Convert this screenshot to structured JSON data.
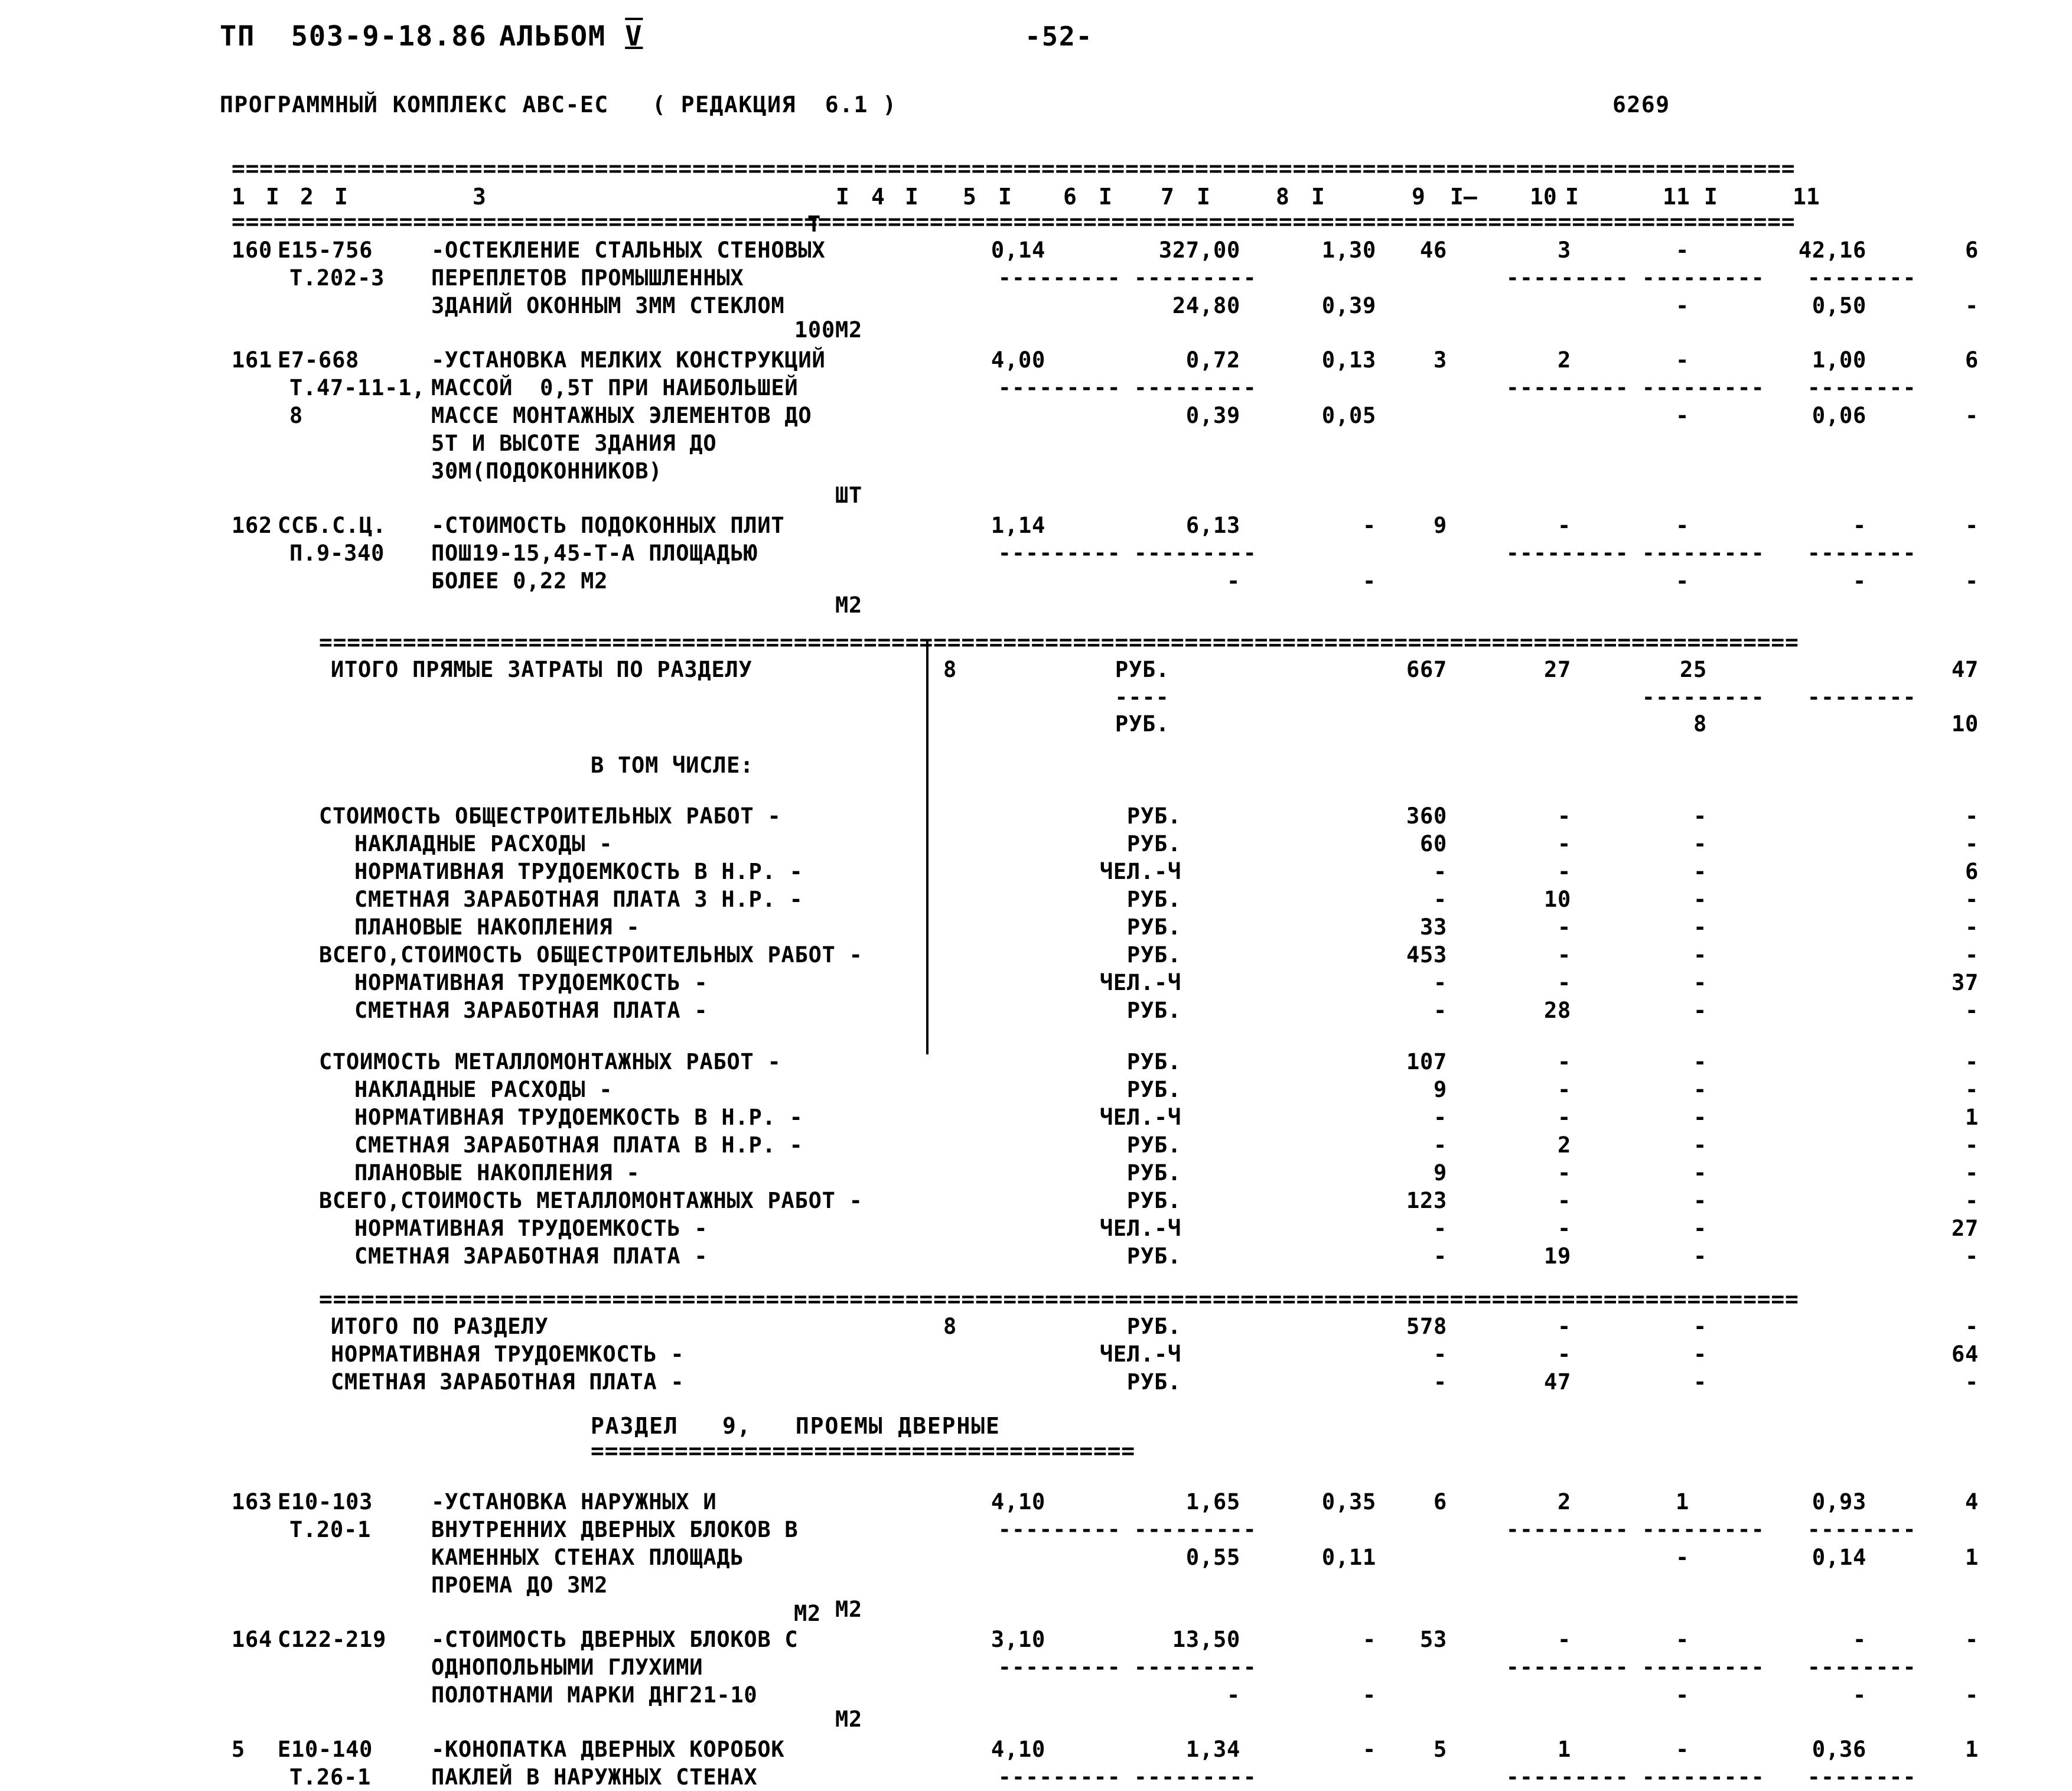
{
  "header": {
    "document_code": "ТП  503-9-18.86",
    "album_label": "АЛЬБОМ",
    "album_number": "V",
    "page_number": "-52-",
    "program_line": "ПРОГРАММНЫЙ КОМПЛЕКС АВС-ЕС   ( РЕДАКЦИЯ  6.1 )",
    "print_code": "6269"
  },
  "table": {
    "column_numbers": [
      "1",
      "2",
      "3",
      "4",
      "5",
      "6",
      "7",
      "8",
      "9",
      "10",
      "11"
    ],
    "separator_char": "=",
    "dash_char": "-",
    "empty_mark": "-"
  },
  "items": [
    {
      "no": "160",
      "code1": "Е15-756",
      "code2": "Т.202-3",
      "code3": "",
      "desc_lines": [
        "-ОСТЕКЛЕНИЕ СТАЛЬНЫХ СТЕНОВЫХ",
        "ПЕРЕПЛЕТОВ ПРОМЫШЛЕННЫХ",
        "ЗДАНИЙ ОКОННЫМ 3ММ СТЕКЛОМ"
      ],
      "unit_top": "Т",
      "unit_bottom": "100М2",
      "qty": "0,14",
      "price_a": "327,00",
      "price_b": "1,30",
      "price_a2": "24,80",
      "price_b2": "0,39",
      "c7": "46",
      "c8": "3",
      "c9": "-",
      "c10": "42,16",
      "c11": "6",
      "c8_2": "",
      "c9_2": "-",
      "c10_2": "0,50",
      "c11_2": "-"
    },
    {
      "no": "161",
      "code1": "Е7-668",
      "code2": "Т.47-11-1,",
      "code3": "8",
      "desc_lines": [
        "-УСТАНОВКА МЕЛКИХ КОНСТРУКЦИЙ",
        "МАССОЙ  0,5Т ПРИ НАИБОЛЬШЕЙ",
        "МАССЕ МОНТАЖНЫХ ЭЛЕМЕНТОВ ДО",
        "5Т И ВЫСОТЕ ЗДАНИЯ ДО",
        "30М(ПОДОКОННИКОВ)"
      ],
      "unit_top": "",
      "unit_bottom": "ШТ",
      "qty": "4,00",
      "price_a": "0,72",
      "price_b": "0,13",
      "price_a2": "0,39",
      "price_b2": "0,05",
      "c7": "3",
      "c8": "2",
      "c9": "-",
      "c10": "1,00",
      "c11": "6",
      "c8_2": "",
      "c9_2": "-",
      "c10_2": "0,06",
      "c11_2": "-"
    },
    {
      "no": "162",
      "code1": "ССБ.С.Ц.",
      "code2": "П.9-340",
      "code3": "",
      "desc_lines": [
        "-СТОИМОСТЬ ПОДОКОННЫХ ПЛИТ",
        "ПОШ19-15,45-Т-А ПЛОЩАДЬЮ",
        "БОЛЕЕ 0,22 М2"
      ],
      "unit_top": "",
      "unit_bottom": "М2",
      "qty": "1,14",
      "price_a": "6,13",
      "price_b": "-",
      "price_a2": "-",
      "price_b2": "-",
      "c7": "9",
      "c8": "-",
      "c9": "-",
      "c10": "-",
      "c11": "-",
      "c8_2": "",
      "c9_2": "-",
      "c10_2": "-",
      "c11_2": "-"
    }
  ],
  "totals_direct": {
    "label": "ИТОГО ПРЯМЫЕ ЗАТРАТЫ ПО РАЗДЕЛУ",
    "section_no": "8",
    "unit_1": "РУБ.",
    "unit_2": "РУБ.",
    "c7": "667",
    "c8": "27",
    "c9": "25",
    "c11": "47",
    "c9_2": "8",
    "c11_2": "10"
  },
  "in_that_number_label": "В ТОМ ЧИСЛЕ:",
  "breakdown_general": [
    {
      "label": "СТОИМОСТЬ ОБЩЕСТРОИТЕЛЬНЫХ РАБОТ -",
      "indent": 0,
      "unit": "РУБ.",
      "c7": "360",
      "c8": "-",
      "c9": "-",
      "c11": "-"
    },
    {
      "label": "НАКЛАДНЫЕ РАСХОДЫ -",
      "indent": 1,
      "unit": "РУБ.",
      "c7": "60",
      "c8": "-",
      "c9": "-",
      "c11": "-"
    },
    {
      "label": "НОРМАТИВНАЯ ТРУДОЕМКОСТЬ В Н.Р. -",
      "indent": 1,
      "unit": "ЧЕЛ.-Ч",
      "c7": "-",
      "c8": "-",
      "c9": "-",
      "c11": "6"
    },
    {
      "label": "СМЕТНАЯ ЗАРАБОТНАЯ ПЛАТА З Н.Р. -",
      "indent": 1,
      "unit": "РУБ.",
      "c7": "-",
      "c8": "10",
      "c9": "-",
      "c11": "-"
    },
    {
      "label": "ПЛАНОВЫЕ НАКОПЛЕНИЯ -",
      "indent": 1,
      "unit": "РУБ.",
      "c7": "33",
      "c8": "-",
      "c9": "-",
      "c11": "-"
    },
    {
      "label": "ВСЕГО,СТОИМОСТЬ ОБЩЕСТРОИТЕЛЬНЫХ РАБОТ -",
      "indent": 0,
      "unit": "РУБ.",
      "c7": "453",
      "c8": "-",
      "c9": "-",
      "c11": "-"
    },
    {
      "label": "НОРМАТИВНАЯ ТРУДОЕМКОСТЬ -",
      "indent": 1,
      "unit": "ЧЕЛ.-Ч",
      "c7": "-",
      "c8": "-",
      "c9": "-",
      "c11": "37"
    },
    {
      "label": "СМЕТНАЯ ЗАРАБОТНАЯ ПЛАТА -",
      "indent": 1,
      "unit": "РУБ.",
      "c7": "-",
      "c8": "28",
      "c9": "-",
      "c11": "-"
    }
  ],
  "breakdown_metal": [
    {
      "label": "СТОИМОСТЬ МЕТАЛЛОМОНТАЖНЫХ РАБОТ -",
      "indent": 0,
      "unit": "РУБ.",
      "c7": "107",
      "c8": "-",
      "c9": "-",
      "c11": "-"
    },
    {
      "label": "НАКЛАДНЫЕ РАСХОДЫ -",
      "indent": 1,
      "unit": "РУБ.",
      "c7": "9",
      "c8": "-",
      "c9": "-",
      "c11": "-"
    },
    {
      "label": "НОРМАТИВНАЯ ТРУДОЕМКОСТЬ В Н.Р. -",
      "indent": 1,
      "unit": "ЧЕЛ.-Ч",
      "c7": "-",
      "c8": "-",
      "c9": "-",
      "c11": "1"
    },
    {
      "label": "СМЕТНАЯ ЗАРАБОТНАЯ ПЛАТА В Н.Р. -",
      "indent": 1,
      "unit": "РУБ.",
      "c7": "-",
      "c8": "2",
      "c9": "-",
      "c11": "-"
    },
    {
      "label": "ПЛАНОВЫЕ НАКОПЛЕНИЯ -",
      "indent": 1,
      "unit": "РУБ.",
      "c7": "9",
      "c8": "-",
      "c9": "-",
      "c11": "-"
    },
    {
      "label": "ВСЕГО,СТОИМОСТЬ МЕТАЛЛОМОНТАЖНЫХ РАБОТ -",
      "indent": 0,
      "unit": "РУБ.",
      "c7": "123",
      "c8": "-",
      "c9": "-",
      "c11": "-"
    },
    {
      "label": "НОРМАТИВНАЯ ТРУДОЕМКОСТЬ -",
      "indent": 1,
      "unit": "ЧЕЛ.-Ч",
      "c7": "-",
      "c8": "-",
      "c9": "-",
      "c11": "27"
    },
    {
      "label": "СМЕТНАЯ ЗАРАБОТНАЯ ПЛАТА -",
      "indent": 1,
      "unit": "РУБ.",
      "c7": "-",
      "c8": "19",
      "c9": "-",
      "c11": "-"
    }
  ],
  "section_totals": [
    {
      "label": "ИТОГО ПО РАЗДЕЛУ",
      "section_no": "8",
      "unit": "РУБ.",
      "c7": "578",
      "c8": "-",
      "c9": "-",
      "c11": "-"
    },
    {
      "label": "НОРМАТИВНАЯ ТРУДОЕМКОСТЬ -",
      "section_no": "",
      "unit": "ЧЕЛ.-Ч",
      "c7": "-",
      "c8": "-",
      "c9": "-",
      "c11": "64"
    },
    {
      "label": "СМЕТНАЯ ЗАРАБОТНАЯ ПЛАТА -",
      "section_no": "",
      "unit": "РУБ.",
      "c7": "-",
      "c8": "47",
      "c9": "-",
      "c11": "-"
    }
  ],
  "next_section": {
    "title_word": "РАЗДЕЛ",
    "number": "9,",
    "name": "ПРОЕМЫ ДВЕРНЫЕ"
  },
  "items2": [
    {
      "no": "163",
      "code1": "Е10-103",
      "code2": "Т.20-1",
      "code3": "",
      "desc_lines": [
        "-УСТАНОВКА НАРУЖНЫХ И",
        "ВНУТРЕННИХ ДВЕРНЫХ БЛОКОВ В",
        "КАМЕННЫХ СТЕНАХ ПЛОЩАДЬ",
        "ПРОЕМА ДО 3М2"
      ],
      "unit_top": "",
      "unit_bottom": "М2",
      "qty": "4,10",
      "price_a": "1,65",
      "price_b": "0,35",
      "price_a2": "0,55",
      "price_b2": "0,11",
      "c7": "6",
      "c8": "2",
      "c9": "1",
      "c10": "0,93",
      "c11": "4",
      "c9_2": "-",
      "c10_2": "0,14",
      "c11_2": "1"
    },
    {
      "no": "164",
      "code1": "С122-219",
      "code2": "",
      "code3": "",
      "desc_lines": [
        "-СТОИМОСТЬ ДВЕРНЫХ БЛОКОВ С",
        "ОДНОПОЛЬНЫМИ ГЛУХИМИ",
        "ПОЛОТНАМИ МАРКИ ДНГ21-10"
      ],
      "unit_top": "М2",
      "unit_bottom": "М2",
      "qty": "3,10",
      "price_a": "13,50",
      "price_b": "-",
      "price_a2": "-",
      "price_b2": "-",
      "c7": "53",
      "c8": "-",
      "c9": "-",
      "c10": "-",
      "c11": "-",
      "c9_2": "-",
      "c10_2": "-",
      "c11_2": "-"
    },
    {
      "no": "5",
      "code1": "Е10-140",
      "code2": "Т.26-1",
      "code3": "",
      "desc_lines": [
        "-КОНОПАТКА ДВЕРНЫХ КОРОБОК",
        "ПАКЛЕЙ В НАРУЖНЫХ СТЕНАХ"
      ],
      "unit_top": "",
      "unit_bottom": "",
      "qty": "4,10",
      "price_a": "1,34",
      "price_b": "-",
      "price_a2": "",
      "price_b2": "",
      "c7": "5",
      "c8": "1",
      "c9": "-",
      "c10": "0,36",
      "c11": "1",
      "c9_2": "",
      "c10_2": "",
      "c11_2": ""
    }
  ]
}
